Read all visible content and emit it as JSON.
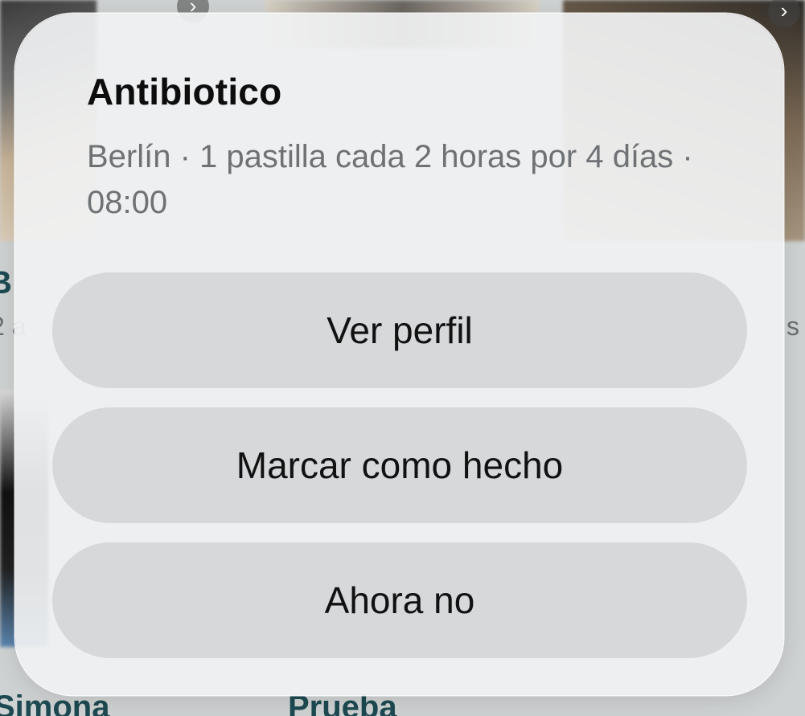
{
  "background": {
    "cards": [
      {
        "label": "Simona"
      },
      {
        "label": "Prueba"
      }
    ],
    "partial_title": "B",
    "partial_sub_left": "2 a",
    "partial_sub_right": "s"
  },
  "sheet": {
    "title": "Antibiotico",
    "subtitle": "Berlín · 1 pastilla cada 2 horas por 4 días · 08:00",
    "actions": [
      {
        "label": "Ver perfil"
      },
      {
        "label": "Marcar como hecho"
      },
      {
        "label": "Ahora no"
      }
    ]
  },
  "colors": {
    "sheet_bg": "#f0f1f2",
    "button_bg": "#cdcfd1",
    "title": "#0d0d0d",
    "subtitle": "#6f7275",
    "bg_label": "#1d4a52"
  }
}
